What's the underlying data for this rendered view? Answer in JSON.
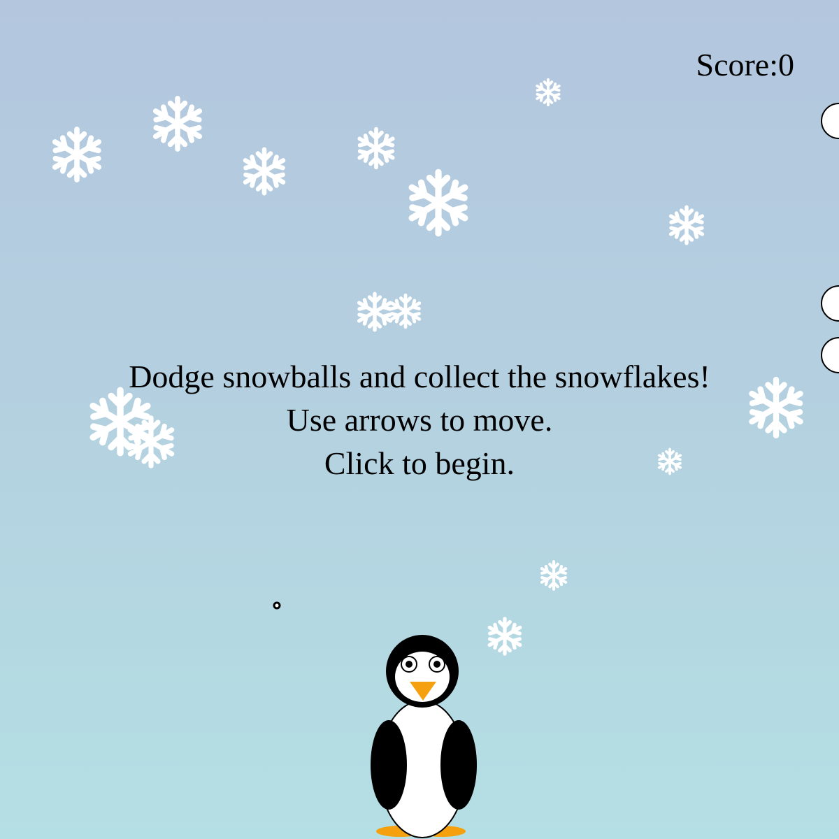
{
  "score": {
    "label": "Score:",
    "value": "0"
  },
  "instructions": {
    "line1": "Dodge snowballs and collect the snowflakes!",
    "line2": "Use arrows to move.",
    "line3": "Click to begin."
  },
  "colors": {
    "sky_top": "#b3c6de",
    "sky_bottom": "#b4dfe4",
    "snowflake": "#ffffff",
    "snowball_fill": "#ffffff",
    "snowball_stroke": "#000000",
    "penguin_black": "#000000",
    "penguin_white": "#ffffff",
    "penguin_orange": "#f5a00f"
  },
  "icons": {
    "snowflake": "snowflake-icon",
    "snowball": "snowball-icon",
    "player": "penguin-icon"
  }
}
